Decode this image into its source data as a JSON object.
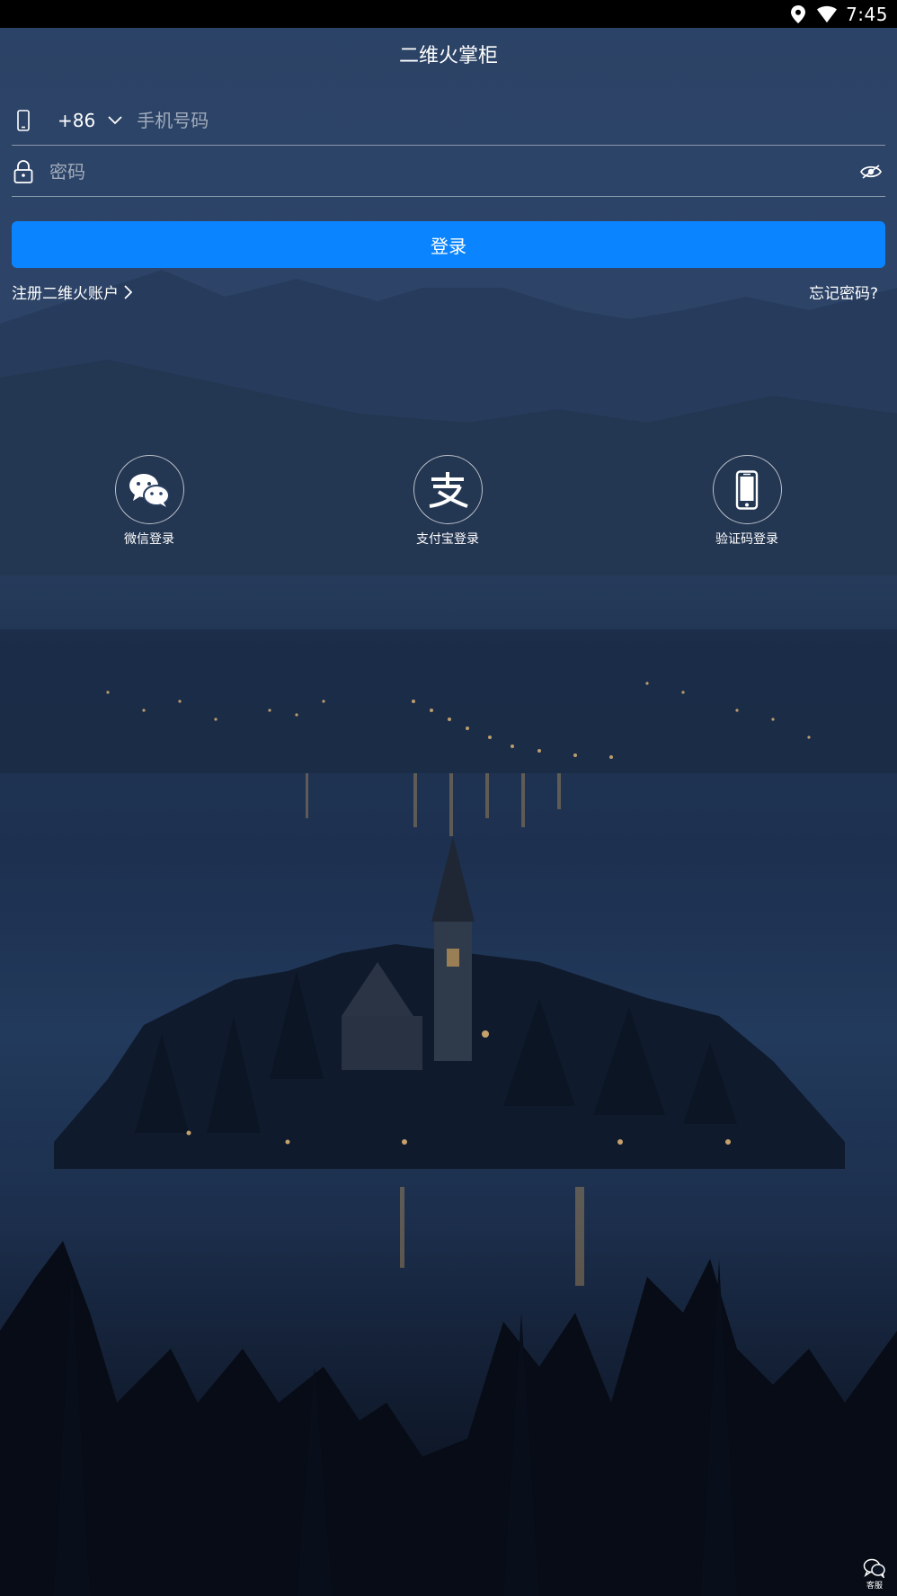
{
  "status_bar": {
    "time": "7:45",
    "icons": [
      "location-icon",
      "wifi-icon"
    ]
  },
  "header": {
    "title": "二维火掌柜"
  },
  "phone_field": {
    "country_code": "+86",
    "placeholder": "手机号码",
    "value": ""
  },
  "password_field": {
    "placeholder": "密码",
    "value": ""
  },
  "login_button": {
    "label": "登录",
    "color": "#0a84ff"
  },
  "links": {
    "register": "注册二维火账户",
    "forgot": "忘记密码?"
  },
  "social_logins": [
    {
      "label": "微信登录",
      "icon": "wechat-icon"
    },
    {
      "label": "支付宝登录",
      "icon": "alipay-icon"
    },
    {
      "label": "验证码登录",
      "icon": "phone-icon"
    }
  ],
  "customer_service": {
    "label": "客服"
  }
}
